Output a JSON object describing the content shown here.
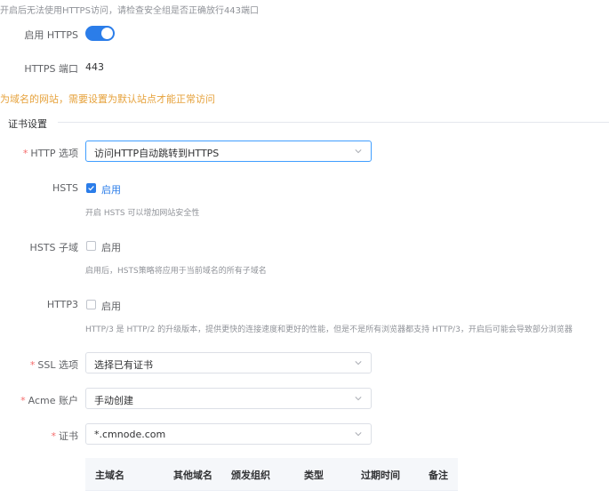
{
  "top_warning": "开启后无法使用HTTPS访问，请检查安全组是否正确放行443端口",
  "https_toggle": {
    "label": "启用 HTTPS",
    "enabled": true
  },
  "https_port": {
    "label": "HTTPS 端口",
    "value": "443"
  },
  "default_site_warning": "为域名的网站，需要设置为默认站点才能正常访问",
  "cert_section": {
    "title": "证书设置"
  },
  "http_option": {
    "label": "HTTP 选项",
    "required": true,
    "selected": "访问HTTP自动跳转到HTTPS"
  },
  "hsts": {
    "label": "HSTS",
    "checkbox_label": "启用",
    "checked": true,
    "help": "开启 HSTS 可以增加网站安全性"
  },
  "hsts_subdomain": {
    "label": "HSTS 子域",
    "checkbox_label": "启用",
    "checked": false,
    "help": "启用后，HSTS策略将应用于当前域名的所有子域名"
  },
  "http3": {
    "label": "HTTP3",
    "checkbox_label": "启用",
    "checked": false,
    "help": "HTTP/3 是 HTTP/2 的升级版本，提供更快的连接速度和更好的性能，但是不是所有浏览器都支持 HTTP/3，开启后可能会导致部分浏览器"
  },
  "ssl_option": {
    "label": "SSL 选项",
    "required": true,
    "selected": "选择已有证书"
  },
  "acme_account": {
    "label": "Acme 账户",
    "required": true,
    "selected": "手动创建"
  },
  "certificate": {
    "label": "证书",
    "required": true,
    "selected": "*.cmnode.com"
  },
  "cert_table": {
    "columns": [
      "主域名",
      "其他域名",
      "颁发组织",
      "类型",
      "过期时间",
      "备注"
    ]
  },
  "colors": {
    "primary": "#2b7de9",
    "required": "#f56c6c",
    "warning": "#e6a23c"
  }
}
